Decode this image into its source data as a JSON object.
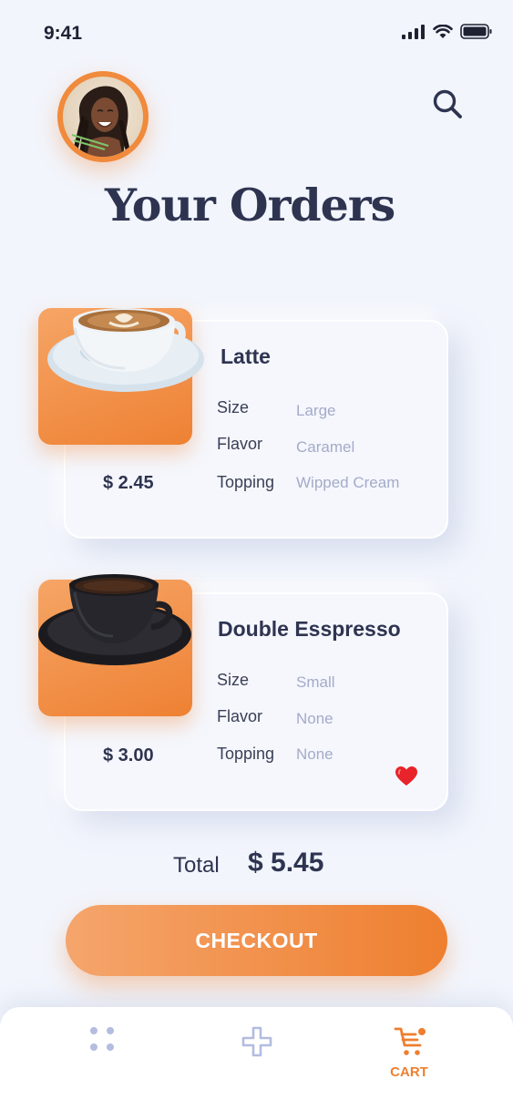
{
  "status_bar": {
    "time": "9:41"
  },
  "header": {
    "title": "Your Orders"
  },
  "orders": [
    {
      "name": "Latte",
      "price": "$ 2.45",
      "attributes": [
        {
          "label": "Size",
          "value": "Large"
        },
        {
          "label": "Flavor",
          "value": "Caramel"
        },
        {
          "label": "Topping",
          "value": "Wipped Cream"
        }
      ]
    },
    {
      "name": "Double Esspresso",
      "price": "$ 3.00",
      "attributes": [
        {
          "label": "Size",
          "value": "Small"
        },
        {
          "label": "Flavor",
          "value": "None"
        },
        {
          "label": "Topping",
          "value": "None"
        }
      ]
    }
  ],
  "summary": {
    "total_label": "Total",
    "total_value": "$ 5.45"
  },
  "checkout_label": "CHECKOUT",
  "bottom_nav": {
    "cart_label": "CART"
  },
  "colors": {
    "accent": "#ee7f2f",
    "text": "#2e3450",
    "muted": "#a4abc8",
    "background": "#f2f5fc"
  }
}
